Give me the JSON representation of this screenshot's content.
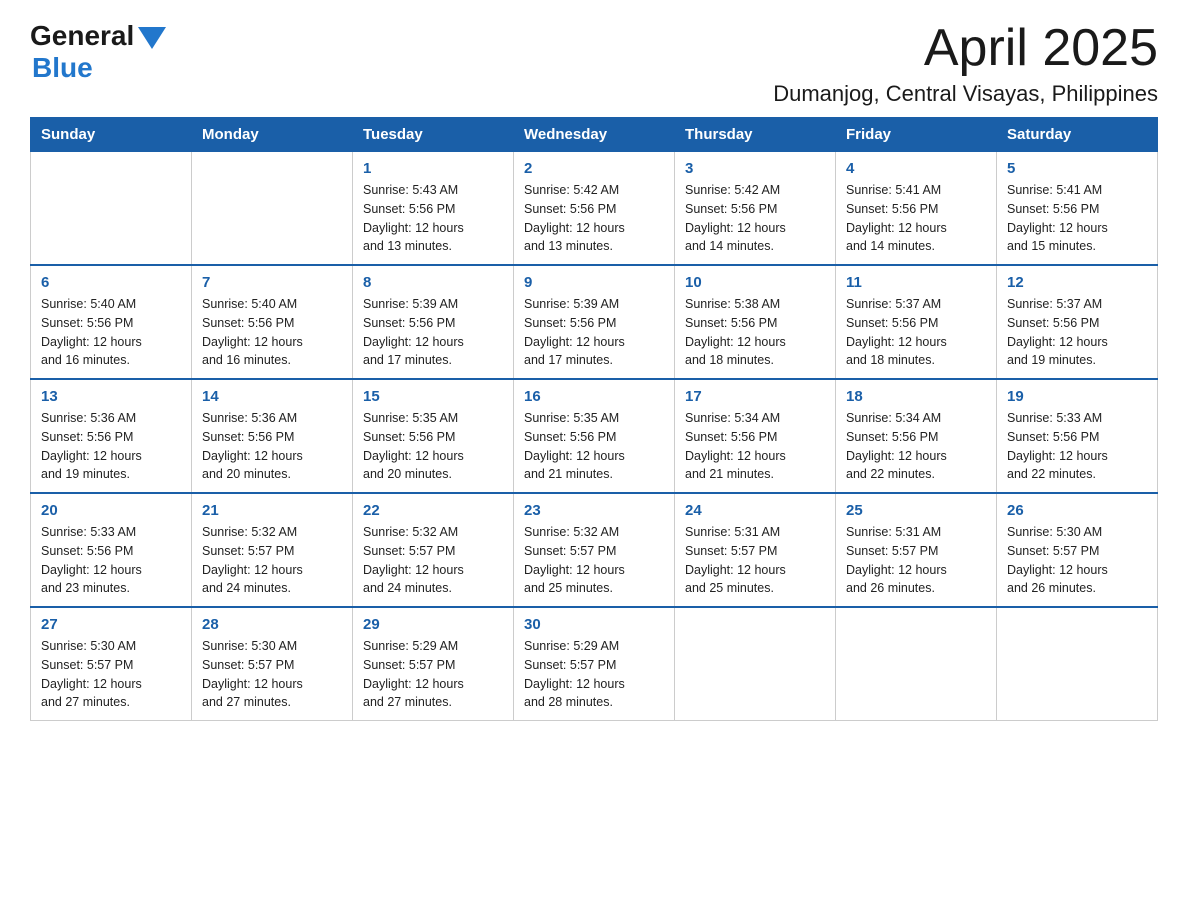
{
  "logo": {
    "general": "General",
    "blue": "Blue"
  },
  "header": {
    "title": "April 2025",
    "location": "Dumanjog, Central Visayas, Philippines"
  },
  "days_of_week": [
    "Sunday",
    "Monday",
    "Tuesday",
    "Wednesday",
    "Thursday",
    "Friday",
    "Saturday"
  ],
  "weeks": [
    [
      {
        "day": "",
        "info": ""
      },
      {
        "day": "",
        "info": ""
      },
      {
        "day": "1",
        "info": "Sunrise: 5:43 AM\nSunset: 5:56 PM\nDaylight: 12 hours\nand 13 minutes."
      },
      {
        "day": "2",
        "info": "Sunrise: 5:42 AM\nSunset: 5:56 PM\nDaylight: 12 hours\nand 13 minutes."
      },
      {
        "day": "3",
        "info": "Sunrise: 5:42 AM\nSunset: 5:56 PM\nDaylight: 12 hours\nand 14 minutes."
      },
      {
        "day": "4",
        "info": "Sunrise: 5:41 AM\nSunset: 5:56 PM\nDaylight: 12 hours\nand 14 minutes."
      },
      {
        "day": "5",
        "info": "Sunrise: 5:41 AM\nSunset: 5:56 PM\nDaylight: 12 hours\nand 15 minutes."
      }
    ],
    [
      {
        "day": "6",
        "info": "Sunrise: 5:40 AM\nSunset: 5:56 PM\nDaylight: 12 hours\nand 16 minutes."
      },
      {
        "day": "7",
        "info": "Sunrise: 5:40 AM\nSunset: 5:56 PM\nDaylight: 12 hours\nand 16 minutes."
      },
      {
        "day": "8",
        "info": "Sunrise: 5:39 AM\nSunset: 5:56 PM\nDaylight: 12 hours\nand 17 minutes."
      },
      {
        "day": "9",
        "info": "Sunrise: 5:39 AM\nSunset: 5:56 PM\nDaylight: 12 hours\nand 17 minutes."
      },
      {
        "day": "10",
        "info": "Sunrise: 5:38 AM\nSunset: 5:56 PM\nDaylight: 12 hours\nand 18 minutes."
      },
      {
        "day": "11",
        "info": "Sunrise: 5:37 AM\nSunset: 5:56 PM\nDaylight: 12 hours\nand 18 minutes."
      },
      {
        "day": "12",
        "info": "Sunrise: 5:37 AM\nSunset: 5:56 PM\nDaylight: 12 hours\nand 19 minutes."
      }
    ],
    [
      {
        "day": "13",
        "info": "Sunrise: 5:36 AM\nSunset: 5:56 PM\nDaylight: 12 hours\nand 19 minutes."
      },
      {
        "day": "14",
        "info": "Sunrise: 5:36 AM\nSunset: 5:56 PM\nDaylight: 12 hours\nand 20 minutes."
      },
      {
        "day": "15",
        "info": "Sunrise: 5:35 AM\nSunset: 5:56 PM\nDaylight: 12 hours\nand 20 minutes."
      },
      {
        "day": "16",
        "info": "Sunrise: 5:35 AM\nSunset: 5:56 PM\nDaylight: 12 hours\nand 21 minutes."
      },
      {
        "day": "17",
        "info": "Sunrise: 5:34 AM\nSunset: 5:56 PM\nDaylight: 12 hours\nand 21 minutes."
      },
      {
        "day": "18",
        "info": "Sunrise: 5:34 AM\nSunset: 5:56 PM\nDaylight: 12 hours\nand 22 minutes."
      },
      {
        "day": "19",
        "info": "Sunrise: 5:33 AM\nSunset: 5:56 PM\nDaylight: 12 hours\nand 22 minutes."
      }
    ],
    [
      {
        "day": "20",
        "info": "Sunrise: 5:33 AM\nSunset: 5:56 PM\nDaylight: 12 hours\nand 23 minutes."
      },
      {
        "day": "21",
        "info": "Sunrise: 5:32 AM\nSunset: 5:57 PM\nDaylight: 12 hours\nand 24 minutes."
      },
      {
        "day": "22",
        "info": "Sunrise: 5:32 AM\nSunset: 5:57 PM\nDaylight: 12 hours\nand 24 minutes."
      },
      {
        "day": "23",
        "info": "Sunrise: 5:32 AM\nSunset: 5:57 PM\nDaylight: 12 hours\nand 25 minutes."
      },
      {
        "day": "24",
        "info": "Sunrise: 5:31 AM\nSunset: 5:57 PM\nDaylight: 12 hours\nand 25 minutes."
      },
      {
        "day": "25",
        "info": "Sunrise: 5:31 AM\nSunset: 5:57 PM\nDaylight: 12 hours\nand 26 minutes."
      },
      {
        "day": "26",
        "info": "Sunrise: 5:30 AM\nSunset: 5:57 PM\nDaylight: 12 hours\nand 26 minutes."
      }
    ],
    [
      {
        "day": "27",
        "info": "Sunrise: 5:30 AM\nSunset: 5:57 PM\nDaylight: 12 hours\nand 27 minutes."
      },
      {
        "day": "28",
        "info": "Sunrise: 5:30 AM\nSunset: 5:57 PM\nDaylight: 12 hours\nand 27 minutes."
      },
      {
        "day": "29",
        "info": "Sunrise: 5:29 AM\nSunset: 5:57 PM\nDaylight: 12 hours\nand 27 minutes."
      },
      {
        "day": "30",
        "info": "Sunrise: 5:29 AM\nSunset: 5:57 PM\nDaylight: 12 hours\nand 28 minutes."
      },
      {
        "day": "",
        "info": ""
      },
      {
        "day": "",
        "info": ""
      },
      {
        "day": "",
        "info": ""
      }
    ]
  ]
}
